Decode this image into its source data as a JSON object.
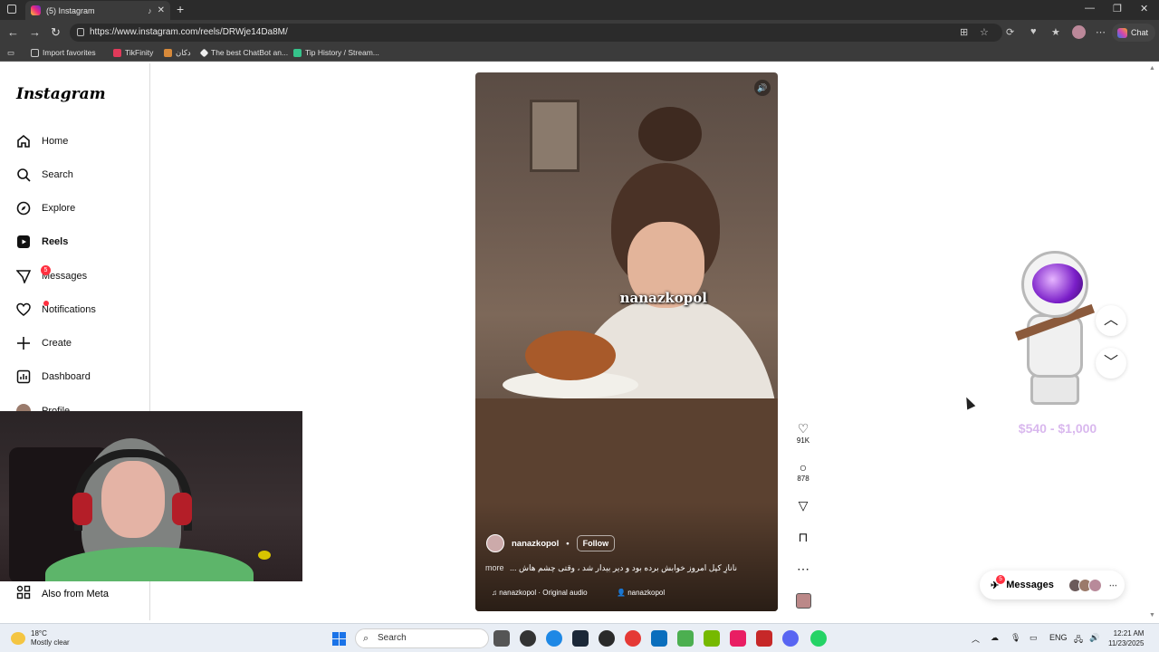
{
  "browser": {
    "tab_title": "(5) Instagram",
    "url": "https://www.instagram.com/reels/DRWje14Da8M/",
    "chat_label": "Chat",
    "bookmarks": [
      {
        "label": "Import favorites"
      },
      {
        "label": "TikFinity"
      },
      {
        "label": "دکان"
      },
      {
        "label": "The best ChatBot an..."
      },
      {
        "label": "Tip History / Stream..."
      }
    ]
  },
  "instagram": {
    "logo": "Instagram",
    "nav": {
      "home": "Home",
      "search": "Search",
      "explore": "Explore",
      "reels": "Reels",
      "messages": "Messages",
      "notifications": "Notifications",
      "create": "Create",
      "dashboard": "Dashboard",
      "profile": "Profile",
      "also_from_meta": "Also from Meta"
    },
    "messages_badge": "5",
    "reel": {
      "overlay_text": "nanazkopol",
      "author": "nanazkopol",
      "separator": "•",
      "follow_label": "Follow",
      "caption": "... نانازِ کپل امروز خوابش برده بود و دیر بیدار شد ، وقتی چشم هاش",
      "more_label": "more",
      "audio": "nanazkopol · Original audio",
      "tagged": "nanazkopol"
    },
    "actions": {
      "likes": "91K",
      "comments": "878"
    },
    "messages_pill": {
      "label": "Messages",
      "badge": "5"
    }
  },
  "overlay": {
    "price_text": "$540 - $1,000"
  },
  "taskbar": {
    "temperature": "18°C",
    "weather": "Mostly clear",
    "search_label": "Search",
    "lang": "ENG",
    "time": "12:21 AM",
    "date": "11/23/2025"
  },
  "colors": {
    "accent_badge": "#ff3040",
    "ig_text": "#111111",
    "chrome_dark": "#3b3b3b"
  }
}
